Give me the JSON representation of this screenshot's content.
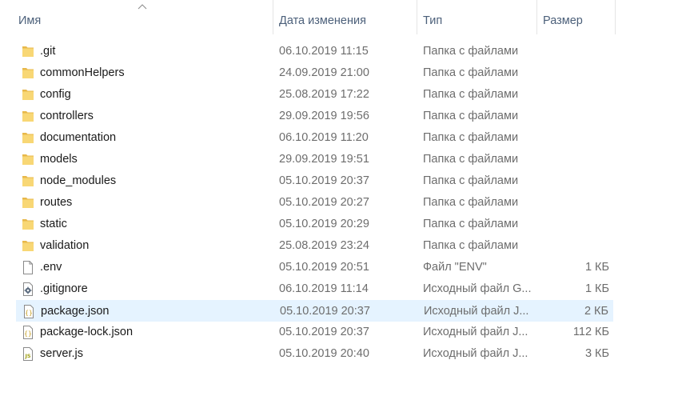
{
  "columns": {
    "name": "Имя",
    "date": "Дата изменения",
    "type": "Тип",
    "size": "Размер"
  },
  "sort": {
    "column": "name",
    "direction": "ascending"
  },
  "colors": {
    "folder": "#f8d775",
    "selection": "#e5f3ff",
    "header_text": "#4c607a"
  },
  "files": [
    {
      "name": ".git",
      "date": "06.10.2019 11:15",
      "type": "Папка с файлами",
      "size": "",
      "icon": "folder-icon"
    },
    {
      "name": "commonHelpers",
      "date": "24.09.2019 21:00",
      "type": "Папка с файлами",
      "size": "",
      "icon": "folder-icon"
    },
    {
      "name": "config",
      "date": "25.08.2019 17:22",
      "type": "Папка с файлами",
      "size": "",
      "icon": "folder-icon"
    },
    {
      "name": "controllers",
      "date": "29.09.2019 19:56",
      "type": "Папка с файлами",
      "size": "",
      "icon": "folder-icon"
    },
    {
      "name": "documentation",
      "date": "06.10.2019 11:20",
      "type": "Папка с файлами",
      "size": "",
      "icon": "folder-icon"
    },
    {
      "name": "models",
      "date": "29.09.2019 19:51",
      "type": "Папка с файлами",
      "size": "",
      "icon": "folder-icon"
    },
    {
      "name": "node_modules",
      "date": "05.10.2019 20:37",
      "type": "Папка с файлами",
      "size": "",
      "icon": "folder-icon"
    },
    {
      "name": "routes",
      "date": "05.10.2019 20:27",
      "type": "Папка с файлами",
      "size": "",
      "icon": "folder-icon"
    },
    {
      "name": "static",
      "date": "05.10.2019 20:29",
      "type": "Папка с файлами",
      "size": "",
      "icon": "folder-icon"
    },
    {
      "name": "validation",
      "date": "25.08.2019 23:24",
      "type": "Папка с файлами",
      "size": "",
      "icon": "folder-icon"
    },
    {
      "name": ".env",
      "date": "05.10.2019 20:51",
      "type": "Файл \"ENV\"",
      "size": "1 КБ",
      "icon": "blank-file-icon"
    },
    {
      "name": ".gitignore",
      "date": "06.10.2019 11:14",
      "type": "Исходный файл G...",
      "size": "1 КБ",
      "icon": "gear-file-icon"
    },
    {
      "name": "package.json",
      "date": "05.10.2019 20:37",
      "type": "Исходный файл J...",
      "size": "2 КБ",
      "icon": "json-file-icon",
      "selected": true
    },
    {
      "name": "package-lock.json",
      "date": "05.10.2019 20:37",
      "type": "Исходный файл J...",
      "size": "112 КБ",
      "icon": "json-file-icon"
    },
    {
      "name": "server.js",
      "date": "05.10.2019 20:40",
      "type": "Исходный файл J...",
      "size": "3 КБ",
      "icon": "js-file-icon"
    }
  ]
}
